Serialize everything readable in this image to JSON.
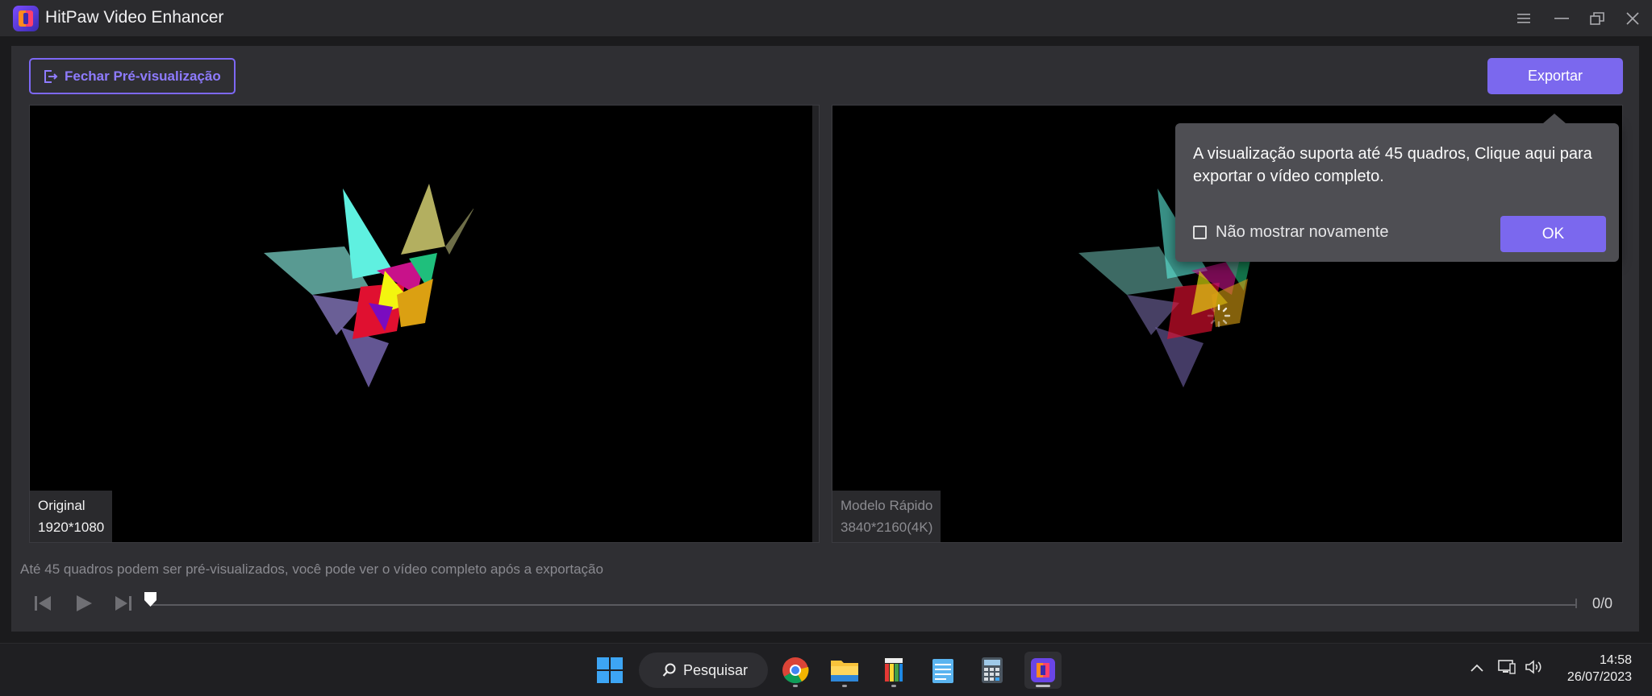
{
  "titlebar": {
    "app_name": "HitPaw Video Enhancer",
    "controls": [
      "menu-icon",
      "minimize-icon",
      "restore-icon",
      "close-icon"
    ]
  },
  "toolbar": {
    "close_preview_label": "Fechar Pré-visualização",
    "export_label": "Exportar"
  },
  "preview": {
    "left": {
      "model": "Original",
      "resolution": "1920*1080"
    },
    "right": {
      "model": "Modelo Rápido",
      "resolution": "3840*2160(4K)"
    }
  },
  "tooltip": {
    "message": "A visualização suporta até 45 quadros, Clique aqui para exportar o vídeo completo.",
    "checkbox_label": "Não mostrar novamente",
    "checkbox_checked": false,
    "ok_label": "OK"
  },
  "player": {
    "note": "Até 45 quadros podem ser pré-visualizados, você pode ver o vídeo completo após a exportação",
    "frame_counter": "0/0"
  },
  "taskbar": {
    "search_label": "Pesquisar",
    "apps": [
      "windows-start-icon",
      "chrome-icon",
      "file-explorer-icon",
      "studio-app-icon",
      "notepad-icon",
      "calculator-icon",
      "hitpaw-icon"
    ],
    "time": "14:58",
    "date": "26/07/2023"
  },
  "colors": {
    "accent": "#7b68ee",
    "background": "#2f2f33",
    "titlebar": "#2b2b2e",
    "tooltip": "#4e4e53"
  }
}
